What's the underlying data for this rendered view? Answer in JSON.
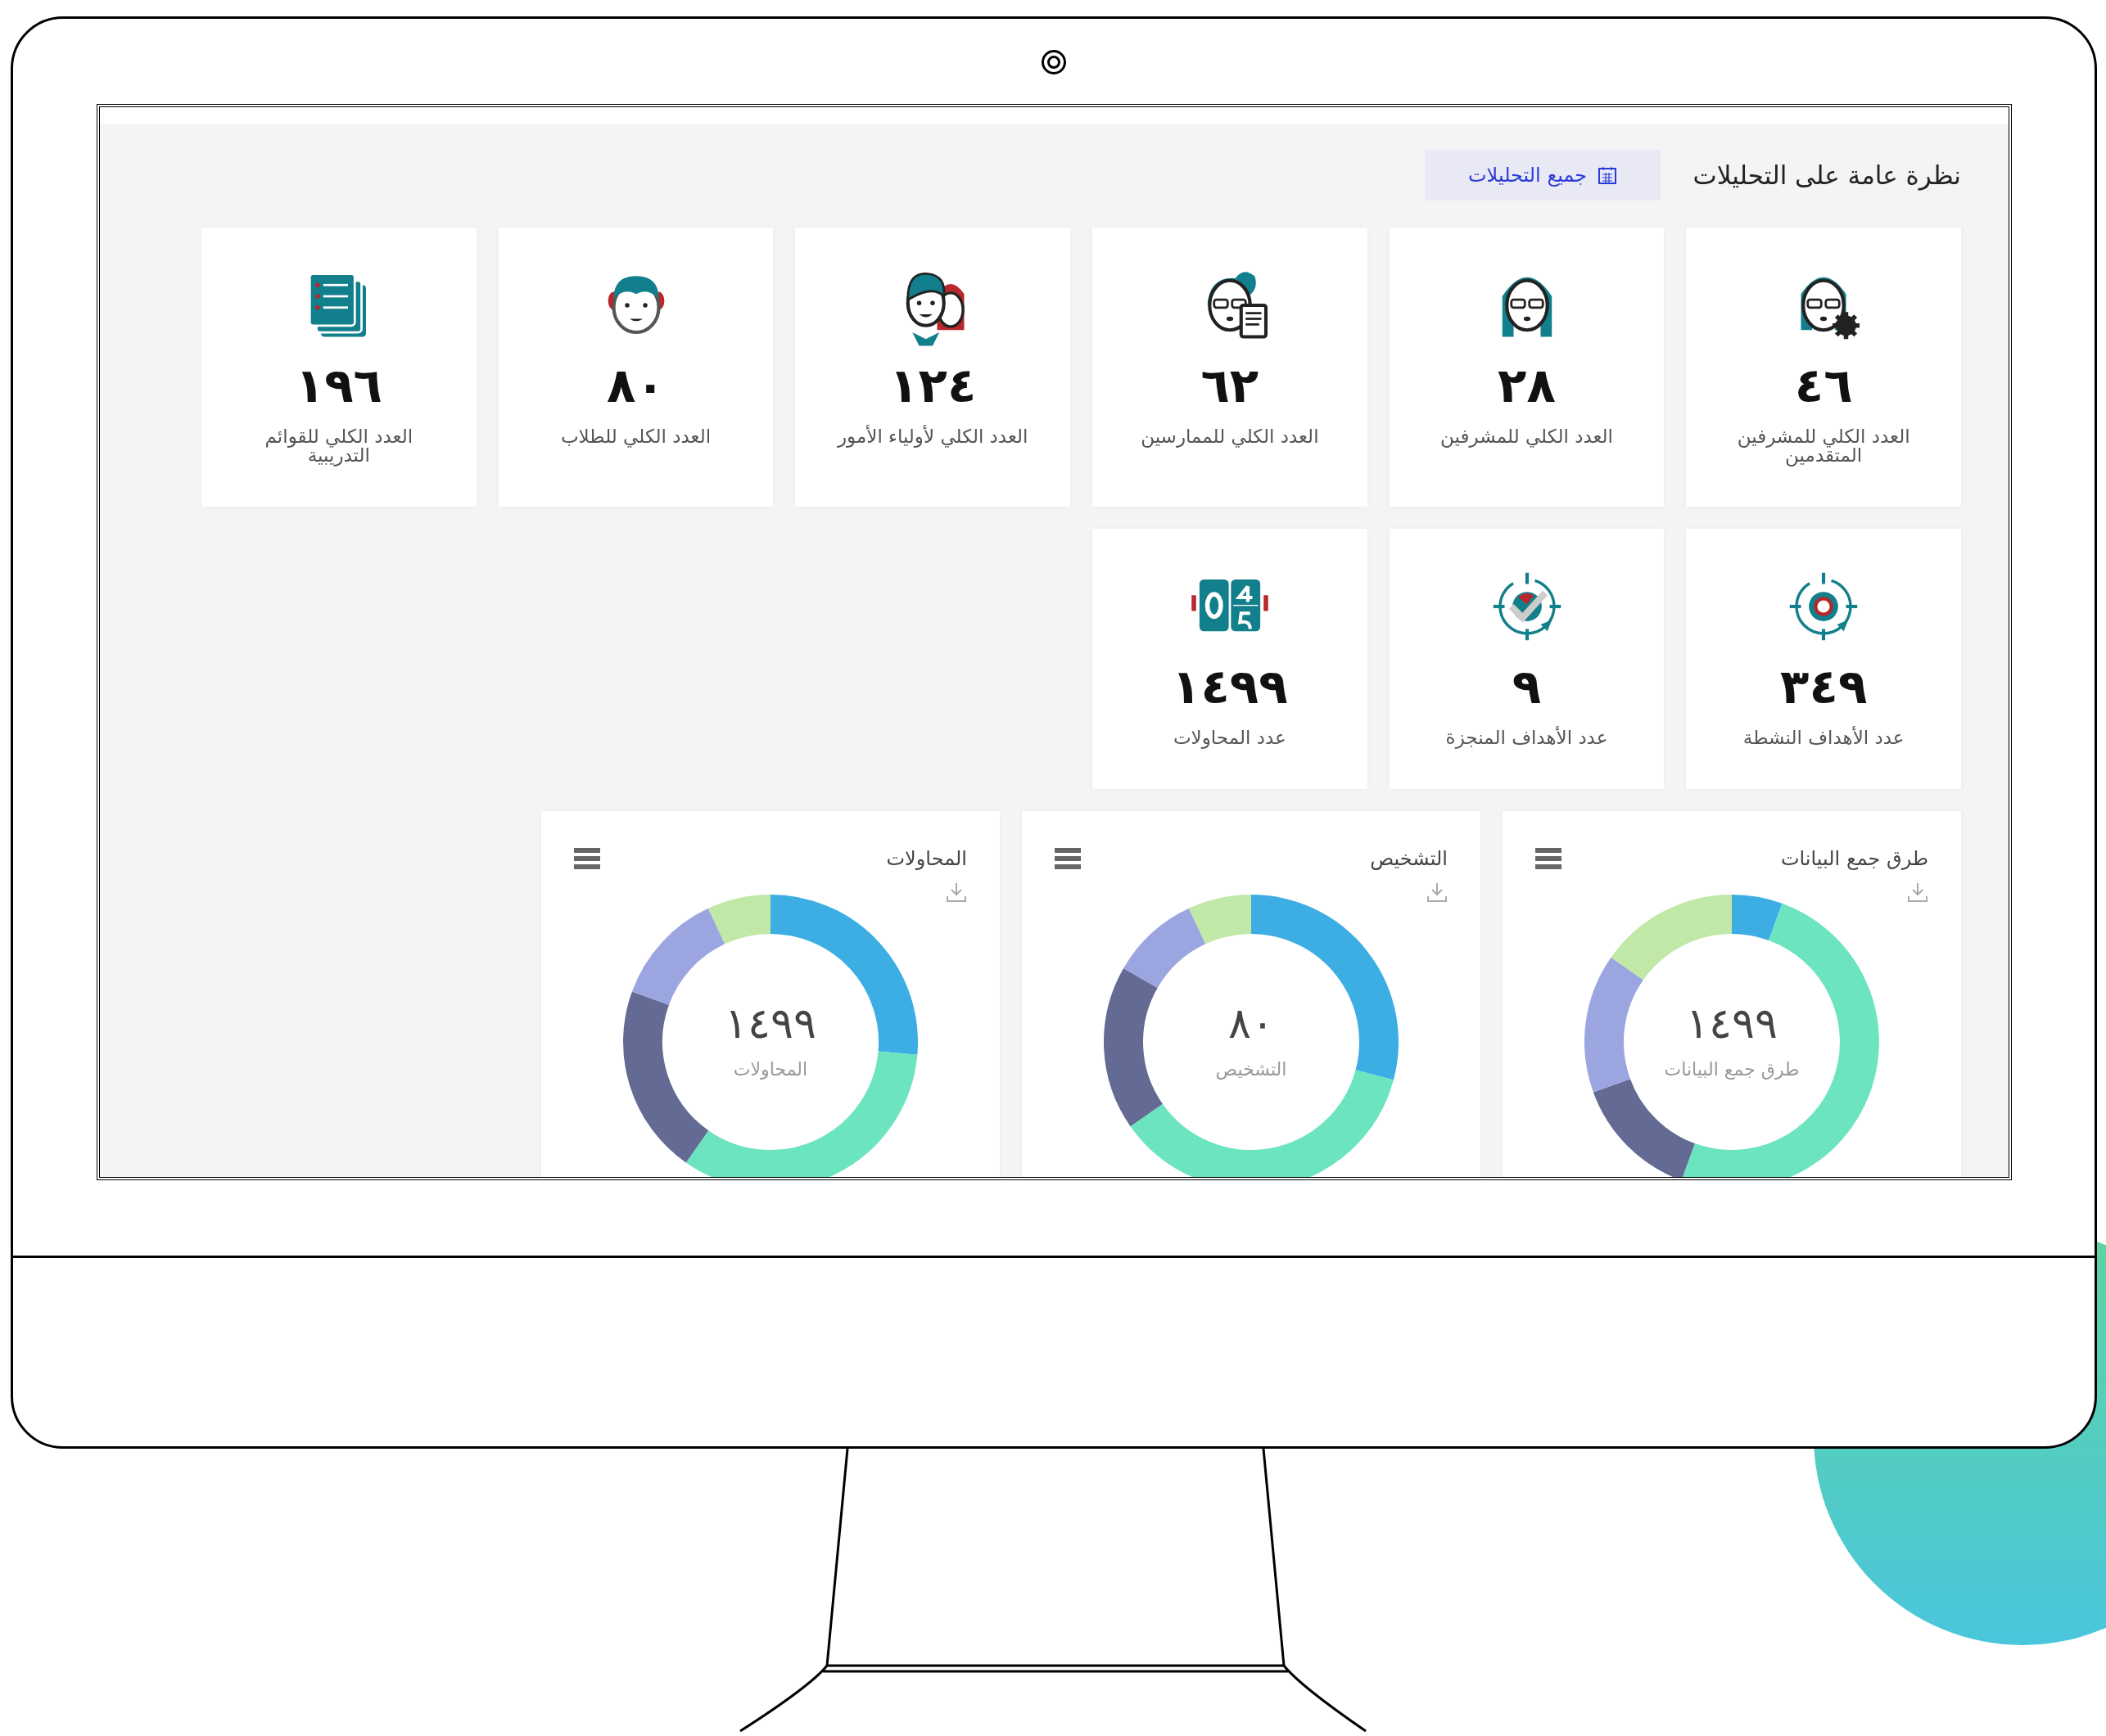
{
  "header": {
    "title": "نظرة عامة على التحليلات",
    "filter_button": "جميع التحليلات"
  },
  "stat_cards": [
    {
      "value": "٤٦",
      "label": "العدد الكلي للمشرفين المتقدمين"
    },
    {
      "value": "٢٨",
      "label": "العدد الكلي للمشرفين"
    },
    {
      "value": "٦٢",
      "label": "العدد الكلي للممارسين"
    },
    {
      "value": "١٢٤",
      "label": "العدد الكلي لأولياء الأمور"
    },
    {
      "value": "٨٠",
      "label": "العدد الكلي للطلاب"
    },
    {
      "value": "١٩٦",
      "label": "العدد الكلي للقوائم التدريبية"
    },
    {
      "value": "٣٤٩",
      "label": "عدد الأهداف النشطة"
    },
    {
      "value": "٩",
      "label": "عدد الأهداف المنجزة"
    },
    {
      "value": "١٤٩٩",
      "label": "عدد المحاولات"
    }
  ],
  "charts": [
    {
      "title": "طرق جمع البيانات",
      "center_value": "١٤٩٩",
      "center_label": "طرق جمع البيانات"
    },
    {
      "title": "التشخيص",
      "center_value": "٨٠",
      "center_label": "التشخيص"
    },
    {
      "title": "المحاولات",
      "center_value": "١٤٩٩",
      "center_label": "المحاولات"
    }
  ]
}
